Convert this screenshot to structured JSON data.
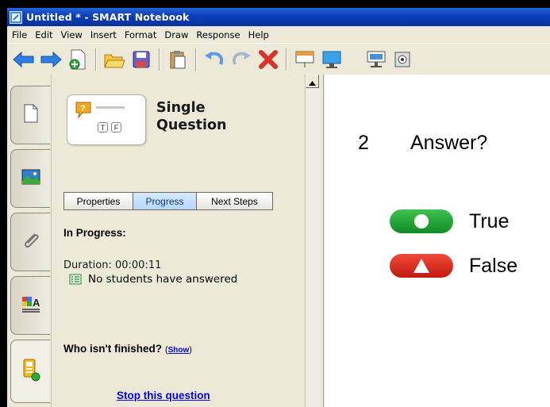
{
  "window": {
    "title": "Untitled * - SMART Notebook"
  },
  "menubar": {
    "items": [
      "File",
      "Edit",
      "View",
      "Insert",
      "Format",
      "Draw",
      "Response",
      "Help"
    ]
  },
  "toolbar": {
    "buttons": [
      "back-arrow-icon",
      "forward-arrow-icon",
      "new-page-icon",
      "open-folder-icon",
      "save-icon",
      "paste-icon",
      "undo-icon",
      "redo-icon",
      "delete-icon",
      "screen-shade-icon",
      "full-screen-icon",
      "display-icon",
      "camera-icon"
    ]
  },
  "sidebar_tabs": [
    "page-sorter-icon",
    "gallery-icon",
    "attachments-icon",
    "properties-icon",
    "response-icon"
  ],
  "panel": {
    "card_title_line1": "Single",
    "card_title_line2": "Question",
    "card_badges": {
      "t": "T",
      "f": "F"
    },
    "tabs": [
      "Properties",
      "Progress",
      "Next Steps"
    ],
    "selected_tab": "Progress",
    "status_heading": "In Progress:",
    "duration": "Duration: 00:00:11",
    "students_status": "No students have answered",
    "who_label": "Who isn't finished?",
    "show_open": "(",
    "show_link": "Show",
    "show_close": ")",
    "stop_link": "Stop this question"
  },
  "canvas": {
    "question_number": "2",
    "question_text": "Answer?",
    "answers": [
      {
        "label": "True",
        "color": "#1aa032",
        "symbol": "circle"
      },
      {
        "label": "False",
        "color": "#e0281a",
        "symbol": "triangle"
      }
    ]
  },
  "colors": {
    "title_bar": "#0a3fb8",
    "link": "#0000ee",
    "selected_tab": "#b8d6fb"
  }
}
